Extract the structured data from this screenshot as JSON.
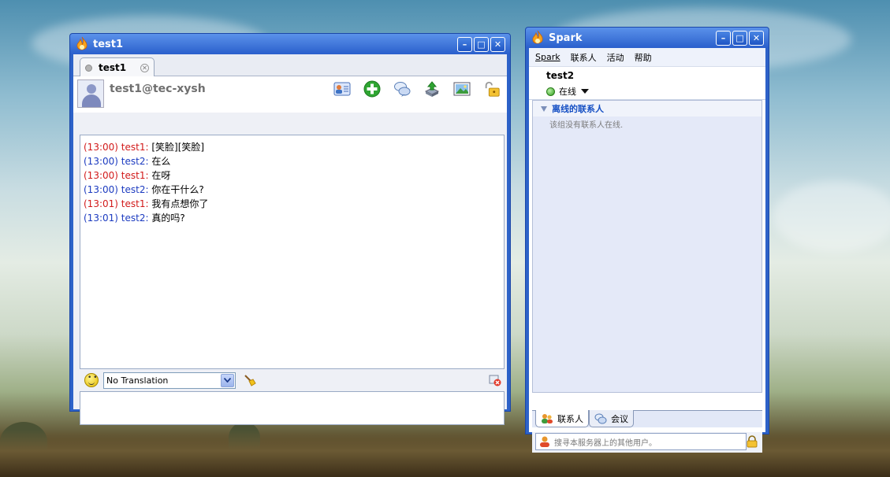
{
  "chat_window": {
    "title": "test1",
    "tab_label": "test1",
    "contact_jid": "test1@tec-xysh",
    "messages": [
      {
        "time": "(13:00)",
        "from": "test1:",
        "text": "[笑脸][笑脸]",
        "side": "other"
      },
      {
        "time": "(13:00)",
        "from": "test2:",
        "text": "在么",
        "side": "me"
      },
      {
        "time": "(13:00)",
        "from": "test1:",
        "text": "在呀",
        "side": "other"
      },
      {
        "time": "(13:00)",
        "from": "test2:",
        "text": "你在干什么?",
        "side": "me"
      },
      {
        "time": "(13:01)",
        "from": "test1:",
        "text": "我有点想你了",
        "side": "other"
      },
      {
        "time": "(13:01)",
        "from": "test2:",
        "text": "真的吗?",
        "side": "me"
      }
    ],
    "translation_selected": "No Translation",
    "toolbar_icons": [
      "contact-card-icon",
      "add-contact-icon",
      "chat-bubbles-icon",
      "send-file-icon",
      "screenshot-icon",
      "unlock-icon"
    ]
  },
  "spark_window": {
    "title": "Spark",
    "menu": {
      "spark": "Spark",
      "contacts": "联系人",
      "actions": "活动",
      "help": "帮助"
    },
    "user_name": "test2",
    "status": "在线",
    "group_name": "离线的联系人",
    "group_empty_note": "该组没有联系人在线.",
    "tabs": {
      "contacts": "联系人",
      "conferences": "会议"
    },
    "search_placeholder": "搜寻本服务器上的其他用户。"
  },
  "colors": {
    "title_bar": "#2d62c8",
    "other_name": "#d21a1a",
    "me_name": "#1c3bc0",
    "group_text": "#1650c4",
    "online": "#2e9d1c"
  }
}
